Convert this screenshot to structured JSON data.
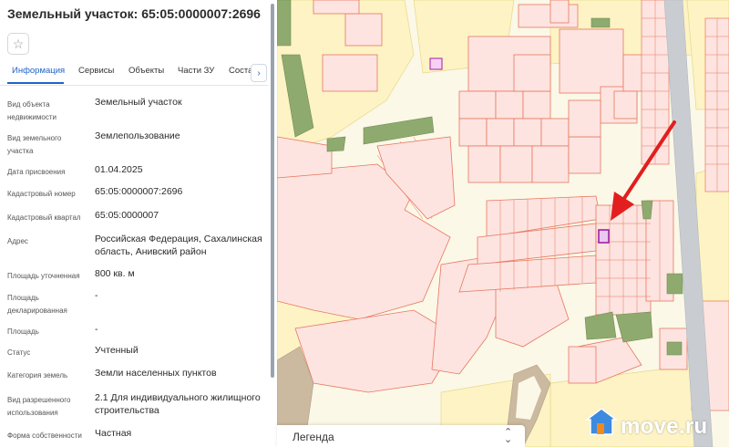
{
  "panel": {
    "title": "Земельный участок: 65:05:0000007:2696",
    "star_icon": "star-outline-icon",
    "tabs": [
      {
        "label": "Информация",
        "active": true
      },
      {
        "label": "Сервисы",
        "active": false
      },
      {
        "label": "Объекты",
        "active": false
      },
      {
        "label": "Части ЗУ",
        "active": false
      },
      {
        "label": "Соста",
        "active": false
      }
    ],
    "next_tab_icon": "chevron-right-icon",
    "rows": [
      {
        "label": "Вид объекта недвижимости",
        "value": "Земельный участок"
      },
      {
        "label": "Вид земельного участка",
        "value": "Землепользование"
      },
      {
        "label": "Дата присвоения",
        "value": "01.04.2025"
      },
      {
        "label": "Кадастровый номер",
        "value": "65:05:0000007:2696"
      },
      {
        "label": "Кадастровый квартал",
        "value": "65:05:0000007"
      },
      {
        "label": "Адрес",
        "value": "Российская Федерация, Сахалинская область, Анивский район"
      },
      {
        "label": "Площадь уточненная",
        "value": "800 кв. м"
      },
      {
        "label": "Площадь декларированная",
        "value": "-"
      },
      {
        "label": "Площадь",
        "value": "-"
      },
      {
        "label": "Статус",
        "value": "Учтенный"
      },
      {
        "label": "Категория земель",
        "value": "Земли населенных пунктов"
      },
      {
        "label": "Вид разрешенного использования",
        "value": "2.1 Для индивидуального жилищного строительства"
      },
      {
        "label": "Форма собственности",
        "value": "Частная"
      }
    ]
  },
  "map": {
    "legend_label": "Легенда",
    "legend_icon": "chevron-up-down-icon",
    "arrow_icon": "red-arrow-pointer-icon",
    "watermark": "move.ru",
    "watermark_icon": "house-icon",
    "colors": {
      "background": "#fbf8e8",
      "parcel_fill": "#fde4e0",
      "parcel_stroke": "#e8775f",
      "yellow_parcel": "#fdf3c4",
      "green_zone": "#8faa6e",
      "road": "#c9cdd2",
      "selected": "#a21fa8",
      "arrow": "#e21e1e",
      "watermark_accent": "#f08a1c",
      "active_tab": "#1f63c7"
    }
  }
}
